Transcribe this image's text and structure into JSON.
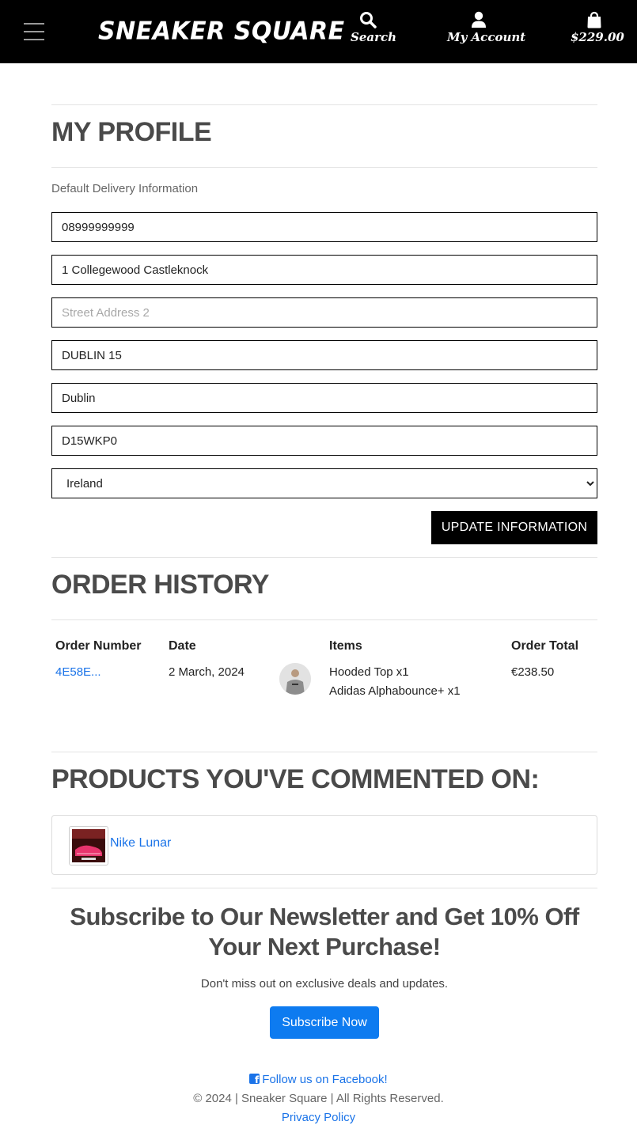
{
  "header": {
    "brand": "SNEAKER SQUARE",
    "search_label": "Search",
    "account_label": "My Account",
    "bag_total": "$229.00"
  },
  "profile": {
    "title": "MY PROFILE",
    "section_label": "Default Delivery Information",
    "phone": "08999999999",
    "street1": "1 Collegewood Castleknock",
    "street2_placeholder": "Street Address 2",
    "town": "DUBLIN 15",
    "county": "Dublin",
    "postcode": "D15WKP0",
    "country": "Ireland",
    "update_button": "UPDATE INFORMATION"
  },
  "orders": {
    "title": "ORDER HISTORY",
    "columns": [
      "Order Number",
      "Date",
      "Items",
      "Order Total"
    ],
    "rows": [
      {
        "number": "4E58E...",
        "date": "2 March, 2024",
        "items": [
          "Hooded Top x1",
          "Adidas Alphabounce+ x1"
        ],
        "total": "€238.50"
      }
    ]
  },
  "commented": {
    "title": "PRODUCTS YOU'VE COMMENTED ON:",
    "items": [
      {
        "name": "Nike Lunar"
      }
    ]
  },
  "newsletter": {
    "title": "Subscribe to Our Newsletter and Get 10% Off Your Next Purchase!",
    "subtitle": "Don't miss out on exclusive deals and updates.",
    "button": "Subscribe Now"
  },
  "footer": {
    "facebook": "Follow us on Facebook!",
    "copyright": "© 2024 | Sneaker Square | All Rights Reserved.",
    "privacy": "Privacy Policy"
  },
  "colors": {
    "header_bg": "#000000",
    "link": "#1a73e8",
    "primary_button": "#0d7bf0",
    "heading": "#4a4a4a"
  }
}
